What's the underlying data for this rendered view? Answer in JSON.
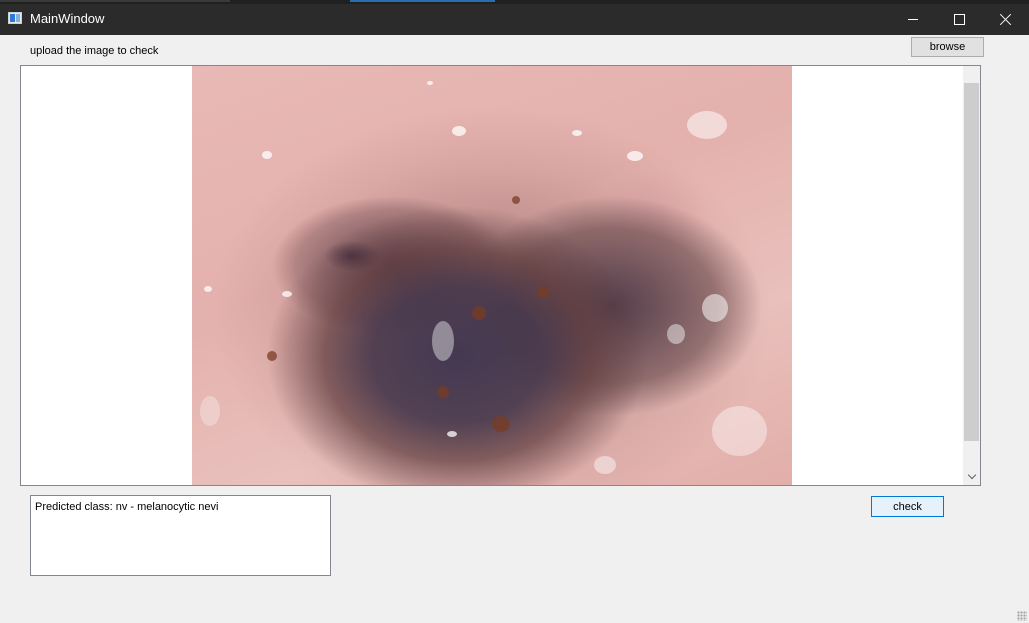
{
  "window": {
    "title": "MainWindow",
    "icon": "app-window-icon",
    "controls": [
      "minimize-icon",
      "maximize-icon",
      "close-icon"
    ]
  },
  "upload": {
    "label": "upload the image to check",
    "browse_label": "browse"
  },
  "viewer": {
    "image": "dermoscopy-lesion-image",
    "scrollbar": "vertical"
  },
  "result": {
    "text": "Predicted class: nv - melanocytic nevi"
  },
  "actions": {
    "check_label": "check"
  },
  "colors": {
    "titlebar": "#2b2b2b",
    "background": "#f0f0f0",
    "accent": "#0078d7"
  }
}
